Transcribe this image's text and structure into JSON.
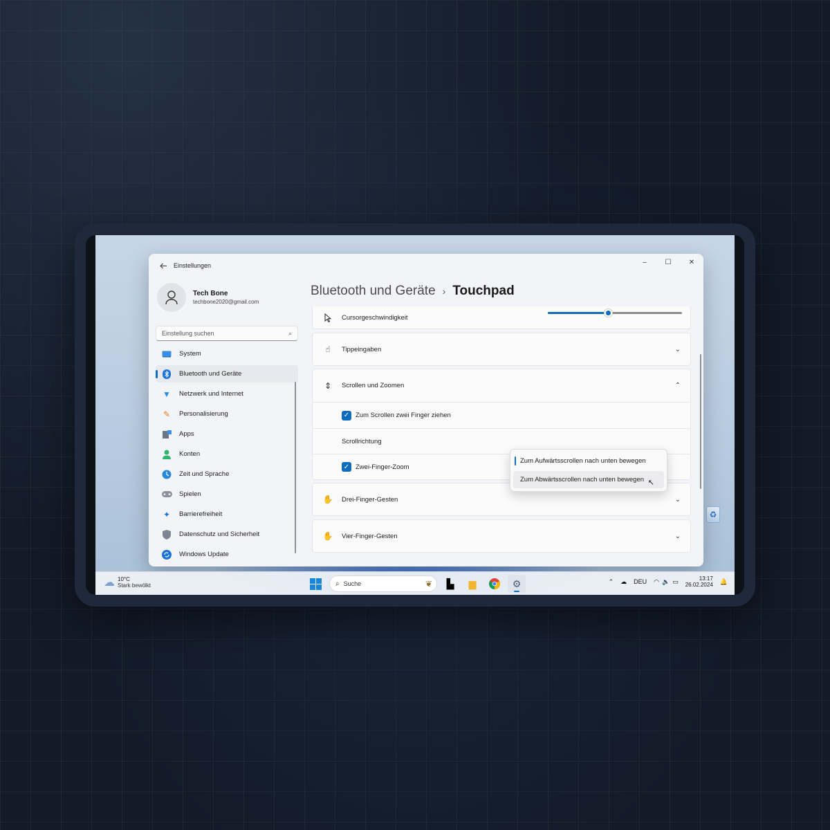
{
  "window": {
    "app_title": "Einstellungen",
    "controls": {
      "minimize": "–",
      "maximize": "☐",
      "close": "✕"
    }
  },
  "profile": {
    "name": "Tech Bone",
    "email": "techbone2020@gmail.com"
  },
  "search": {
    "placeholder": "Einstellung suchen"
  },
  "sidebar": {
    "items": [
      {
        "label": "System",
        "icon": "monitor-icon"
      },
      {
        "label": "Bluetooth und Geräte",
        "icon": "bluetooth-icon",
        "active": true
      },
      {
        "label": "Netzwerk und Internet",
        "icon": "wifi-icon"
      },
      {
        "label": "Personalisierung",
        "icon": "brush-icon"
      },
      {
        "label": "Apps",
        "icon": "apps-icon"
      },
      {
        "label": "Konten",
        "icon": "account-icon"
      },
      {
        "label": "Zeit und Sprache",
        "icon": "globe-clock-icon"
      },
      {
        "label": "Spielen",
        "icon": "gamepad-icon"
      },
      {
        "label": "Barrierefreiheit",
        "icon": "accessibility-icon"
      },
      {
        "label": "Datenschutz und Sicherheit",
        "icon": "shield-icon"
      },
      {
        "label": "Windows Update",
        "icon": "update-icon"
      }
    ]
  },
  "breadcrumb": {
    "parent": "Bluetooth und Geräte",
    "separator": "›",
    "current": "Touchpad"
  },
  "settings": {
    "cursor_speed": {
      "label": "Cursorgeschwindigkeit",
      "value_fraction": 0.45
    },
    "taps": {
      "label": "Tippeingaben"
    },
    "scroll_zoom": {
      "label": "Scrollen und Zoomen",
      "two_finger_scroll": {
        "label": "Zum Scrollen zwei Finger ziehen",
        "checked": true
      },
      "scroll_direction": {
        "label": "Scrollrichtung"
      },
      "pinch_zoom": {
        "label": "Zwei-Finger-Zoom",
        "checked": true
      }
    },
    "three_finger": {
      "label": "Drei-Finger-Gesten"
    },
    "four_finger": {
      "label": "Vier-Finger-Gesten"
    }
  },
  "dropdown": {
    "options": [
      "Zum Aufwärtsscrollen nach unten bewegen",
      "Zum Abwärtsscrollen nach unten bewegen"
    ],
    "selected_index": 0,
    "hover_index": 1
  },
  "taskbar": {
    "weather": {
      "temp": "10°C",
      "condition": "Stark bewölkt"
    },
    "search_placeholder": "Suche",
    "language": "DEU",
    "time": "13:17",
    "date": "26.02.2024"
  },
  "colors": {
    "accent": "#0f6cbd"
  }
}
